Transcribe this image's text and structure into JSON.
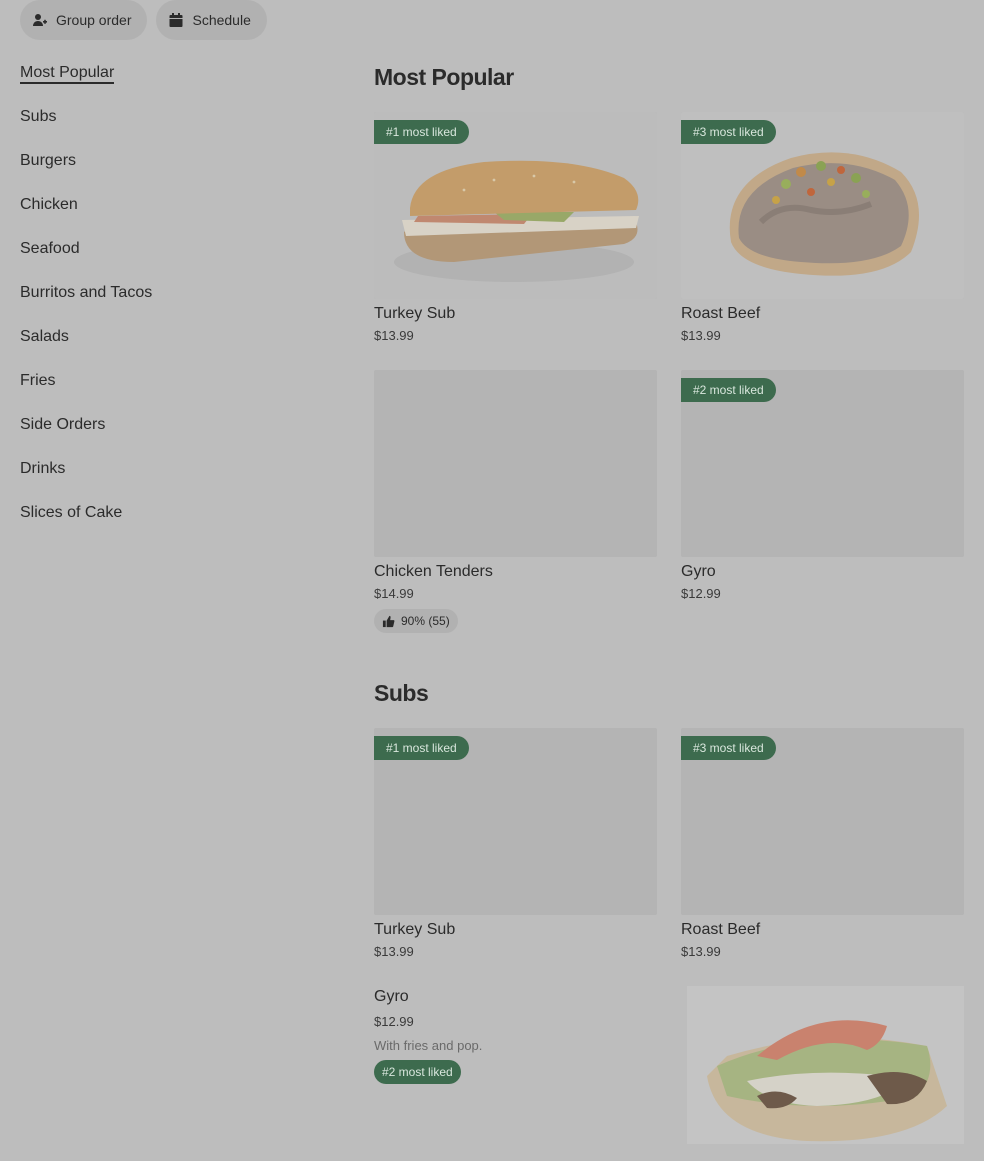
{
  "toolbar": {
    "group_order_label": "Group order",
    "schedule_label": "Schedule",
    "group_order_icon": "person-plus-icon",
    "schedule_icon": "calendar-icon"
  },
  "sidebar": {
    "items": [
      {
        "label": "Most Popular",
        "active": true
      },
      {
        "label": "Subs"
      },
      {
        "label": "Burgers"
      },
      {
        "label": "Chicken"
      },
      {
        "label": "Seafood"
      },
      {
        "label": "Burritos and Tacos"
      },
      {
        "label": "Salads"
      },
      {
        "label": "Fries"
      },
      {
        "label": "Side Orders"
      },
      {
        "label": "Drinks"
      },
      {
        "label": "Slices of Cake"
      }
    ]
  },
  "most_popular": {
    "title": "Most Popular",
    "items": [
      {
        "name": "Turkey Sub",
        "price": "$13.99",
        "badge": "#1 most liked",
        "image": "turkey-sub"
      },
      {
        "name": "Roast Beef",
        "price": "$13.99",
        "badge": "#3 most liked",
        "image": "roast-beef"
      },
      {
        "name": "Chicken Tenders",
        "price": "$14.99",
        "rating": "90% (55)",
        "rating_icon": "thumbs-up-icon"
      },
      {
        "name": "Gyro",
        "price": "$12.99",
        "badge": "#2 most liked"
      }
    ]
  },
  "subs": {
    "title": "Subs",
    "items": [
      {
        "name": "Turkey Sub",
        "price": "$13.99",
        "badge": "#1 most liked"
      },
      {
        "name": "Roast Beef",
        "price": "$13.99",
        "badge": "#3 most liked"
      },
      {
        "name": "Gyro",
        "price": "$12.99",
        "description": "With fries and pop.",
        "badge": "#2 most liked",
        "image": "gyro"
      }
    ]
  },
  "colors": {
    "page_background": "#bdbdbd",
    "badge_background": "#3d6b4e",
    "pill_background": "#b1b1b1",
    "text": "#2b2b2b"
  }
}
